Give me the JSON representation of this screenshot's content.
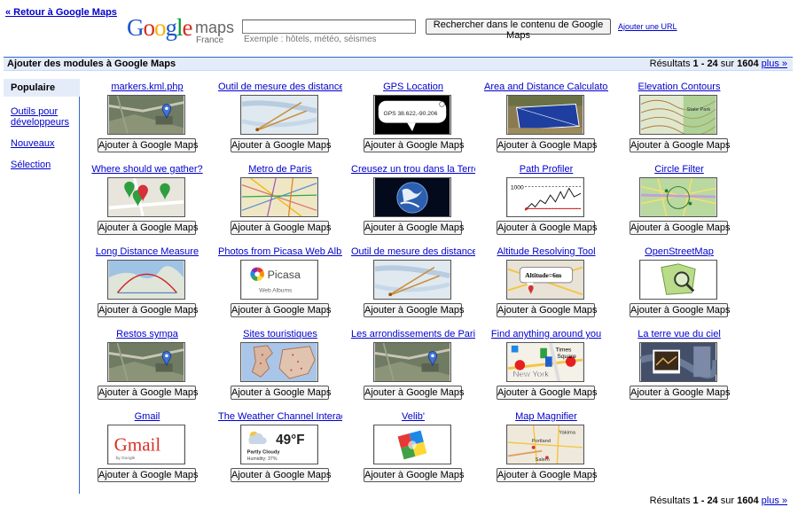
{
  "back_link": "« Retour à Google Maps",
  "logo": {
    "google": "Google",
    "maps": "maps",
    "country": "France"
  },
  "search": {
    "value": "",
    "example": "Exemple : hôtels, météo, séismes",
    "button": "Rechercher dans le contenu de Google Maps",
    "add_url": "Ajouter une URL"
  },
  "header": {
    "title": "Ajouter des modules à Google Maps",
    "results_prefix": "Résultats",
    "results_range": "1 - 24",
    "results_of": "sur",
    "results_total": "1604",
    "more": "plus »"
  },
  "sidebar": {
    "items": [
      {
        "label": "Populaire"
      },
      {
        "label": "Outils pour développeurs"
      },
      {
        "label": "Nouveaux"
      },
      {
        "label": "Sélection"
      }
    ]
  },
  "modules": [
    {
      "title": "markers.kml.php",
      "thumb": "aerial-pin",
      "button": "Ajouter à Google Maps"
    },
    {
      "title": "Outil de mesure des distances",
      "thumb": "map-measure",
      "button": "Ajouter à Google Maps"
    },
    {
      "title": "GPS Location",
      "thumb": "gps",
      "button": "Ajouter à Google Maps"
    },
    {
      "title": "Area and Distance Calculator",
      "thumb": "area",
      "button": "Ajouter à Google Maps"
    },
    {
      "title": "Elevation Contours",
      "thumb": "contours",
      "button": "Ajouter à Google Maps"
    },
    {
      "title": "Where should we gather?",
      "thumb": "pins",
      "button": "Ajouter à Google Maps"
    },
    {
      "title": "Metro de Paris",
      "thumb": "metro",
      "button": "Ajouter à Google Maps"
    },
    {
      "title": "Creusez un trou dans la Terre",
      "thumb": "earth",
      "button": "Ajouter à Google Maps"
    },
    {
      "title": "Path Profiler",
      "thumb": "profile",
      "button": "Ajouter à Google Maps"
    },
    {
      "title": "Circle Filter",
      "thumb": "circle",
      "button": "Ajouter à Google Maps"
    },
    {
      "title": "Long Distance Measure",
      "thumb": "long",
      "button": "Ajouter à Google Maps"
    },
    {
      "title": "Photos from Picasa Web Albums",
      "thumb": "picasa",
      "button": "Ajouter à Google Maps"
    },
    {
      "title": "Outil de mesure des distances",
      "thumb": "map-measure",
      "button": "Ajouter à Google Maps"
    },
    {
      "title": "Altitude Resolving Tool",
      "thumb": "altitude",
      "button": "Ajouter à Google Maps"
    },
    {
      "title": "OpenStreetMap",
      "thumb": "osm",
      "button": "Ajouter à Google Maps"
    },
    {
      "title": "Restos sympa",
      "thumb": "aerial-pin",
      "button": "Ajouter à Google Maps"
    },
    {
      "title": "Sites touristiques",
      "thumb": "sites",
      "button": "Ajouter à Google Maps"
    },
    {
      "title": "Les arrondissements de Paris",
      "thumb": "aerial-pin",
      "button": "Ajouter à Google Maps"
    },
    {
      "title": "Find anything around you",
      "thumb": "find",
      "button": "Ajouter à Google Maps"
    },
    {
      "title": "La terre vue du ciel",
      "thumb": "sky",
      "button": "Ajouter à Google Maps"
    },
    {
      "title": "Gmail",
      "thumb": "gmail",
      "button": "Ajouter à Google Maps"
    },
    {
      "title": "The Weather Channel Interac...",
      "thumb": "weather",
      "button": "Ajouter à Google Maps"
    },
    {
      "title": "Velib'",
      "thumb": "velib",
      "button": "Ajouter à Google Maps"
    },
    {
      "title": "Map Magnifier",
      "thumb": "magnifier",
      "button": "Ajouter à Google Maps"
    }
  ],
  "thumb_text": {
    "gps": "GPS 38.622,-90.206",
    "profile": "1000",
    "altitude": "Altitude=6m",
    "picasa_brand": "Picasa",
    "picasa_sub": "Web Albums",
    "gmail": "Gmail",
    "gmail_by": "by Google",
    "weather_temp": "49°F",
    "weather_cond": "Partly Cloudy",
    "weather_hum": "Humidity: 37%",
    "find_times": "Times",
    "find_square": "Square",
    "find_ny": "New York",
    "magnifier_yakima": "Yakima",
    "magnifier_portland": "Portland",
    "magnifier_salem": "Salem",
    "contours_park": "State Park"
  },
  "footer": {
    "results_prefix": "Résultats",
    "results_range": "1 - 24",
    "results_of": "sur",
    "results_total": "1604",
    "more": "plus »"
  },
  "colors": {
    "link": "#0000cc",
    "header_bg": "#e5ecf9",
    "header_border": "#3366cc"
  }
}
